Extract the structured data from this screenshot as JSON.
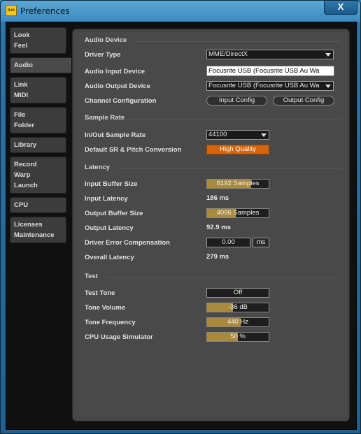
{
  "window": {
    "title": "Preferences",
    "app_icon_text": "live",
    "close_glyph": "X"
  },
  "sidebar": {
    "groups": [
      {
        "items": [
          "Look",
          "Feel"
        ],
        "active": false
      },
      {
        "items": [
          "Audio"
        ],
        "active": true
      },
      {
        "items": [
          "Link",
          "MIDI"
        ],
        "active": false
      },
      {
        "items": [
          "File",
          "Folder"
        ],
        "active": false
      },
      {
        "items": [
          "Library"
        ],
        "active": false
      },
      {
        "items": [
          "Record",
          "Warp",
          "Launch"
        ],
        "active": false
      },
      {
        "items": [
          "CPU"
        ],
        "active": false
      },
      {
        "items": [
          "Licenses",
          "Maintenance"
        ],
        "active": false
      }
    ]
  },
  "audio_device": {
    "header": "Audio Device",
    "driver_type_label": "Driver Type",
    "driver_type_value": "MME/DirectX",
    "input_device_label": "Audio Input Device",
    "input_device_value": "Focusrite USB (Focusrite USB Au Wa",
    "output_device_label": "Audio Output Device",
    "output_device_value": "Focusrite USB (Focusrite USB Au Wa",
    "channel_config_label": "Channel Configuration",
    "input_config_button": "Input Config",
    "output_config_button": "Output Config"
  },
  "sample_rate": {
    "header": "Sample Rate",
    "rate_label": "In/Out Sample Rate",
    "rate_value": "44100",
    "conversion_label": "Default SR & Pitch Conversion",
    "conversion_value": "High Quality"
  },
  "latency": {
    "header": "Latency",
    "input_buffer_label": "Input Buffer Size",
    "input_buffer_value": "8192 Samples",
    "input_buffer_fraction": 0.72,
    "input_latency_label": "Input Latency",
    "input_latency_value": "186 ms",
    "output_buffer_label": "Output Buffer Size",
    "output_buffer_value": "4096 Samples",
    "output_buffer_fraction": 0.47,
    "output_latency_label": "Output Latency",
    "output_latency_value": "92.9 ms",
    "driver_comp_label": "Driver Error Compensation",
    "driver_comp_value": "0.00",
    "driver_comp_unit": "ms",
    "overall_latency_label": "Overall Latency",
    "overall_latency_value": "279 ms"
  },
  "test": {
    "header": "Test",
    "tone_label": "Test Tone",
    "tone_value": "Off",
    "volume_label": "Tone Volume",
    "volume_value": "-36 dB",
    "volume_fraction": 0.42,
    "frequency_label": "Tone Frequency",
    "frequency_value": "440 Hz",
    "frequency_fraction": 0.55,
    "cpu_sim_label": "CPU Usage Simulator",
    "cpu_sim_value": "50 %",
    "cpu_sim_fraction": 0.5
  },
  "colors": {
    "accent_orange": "#d4650d",
    "slider_fill": "#a98a3c",
    "panel_bg": "#494949"
  }
}
